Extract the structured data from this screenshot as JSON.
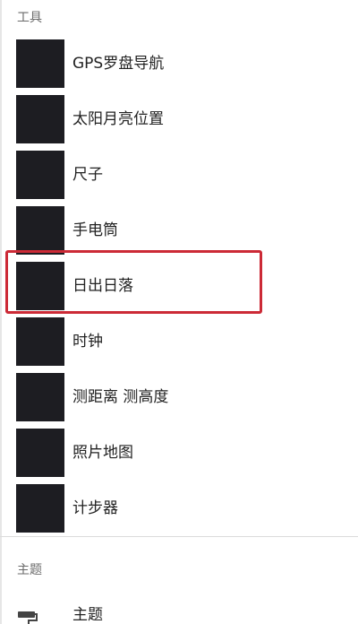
{
  "tools_section": {
    "title": "工具",
    "items": [
      {
        "label": "GPS罗盘导航"
      },
      {
        "label": "太阳月亮位置"
      },
      {
        "label": "尺子"
      },
      {
        "label": "手电筒"
      },
      {
        "label": "日出日落"
      },
      {
        "label": "时钟"
      },
      {
        "label": "测距离 测高度"
      },
      {
        "label": "照片地图"
      },
      {
        "label": "计步器"
      }
    ]
  },
  "theme_section": {
    "title": "主题",
    "item_label": "主题",
    "icon": "paint-roller-icon"
  },
  "colors": {
    "highlight": "#cc2a36",
    "thumbnail": "#1d1d22"
  }
}
